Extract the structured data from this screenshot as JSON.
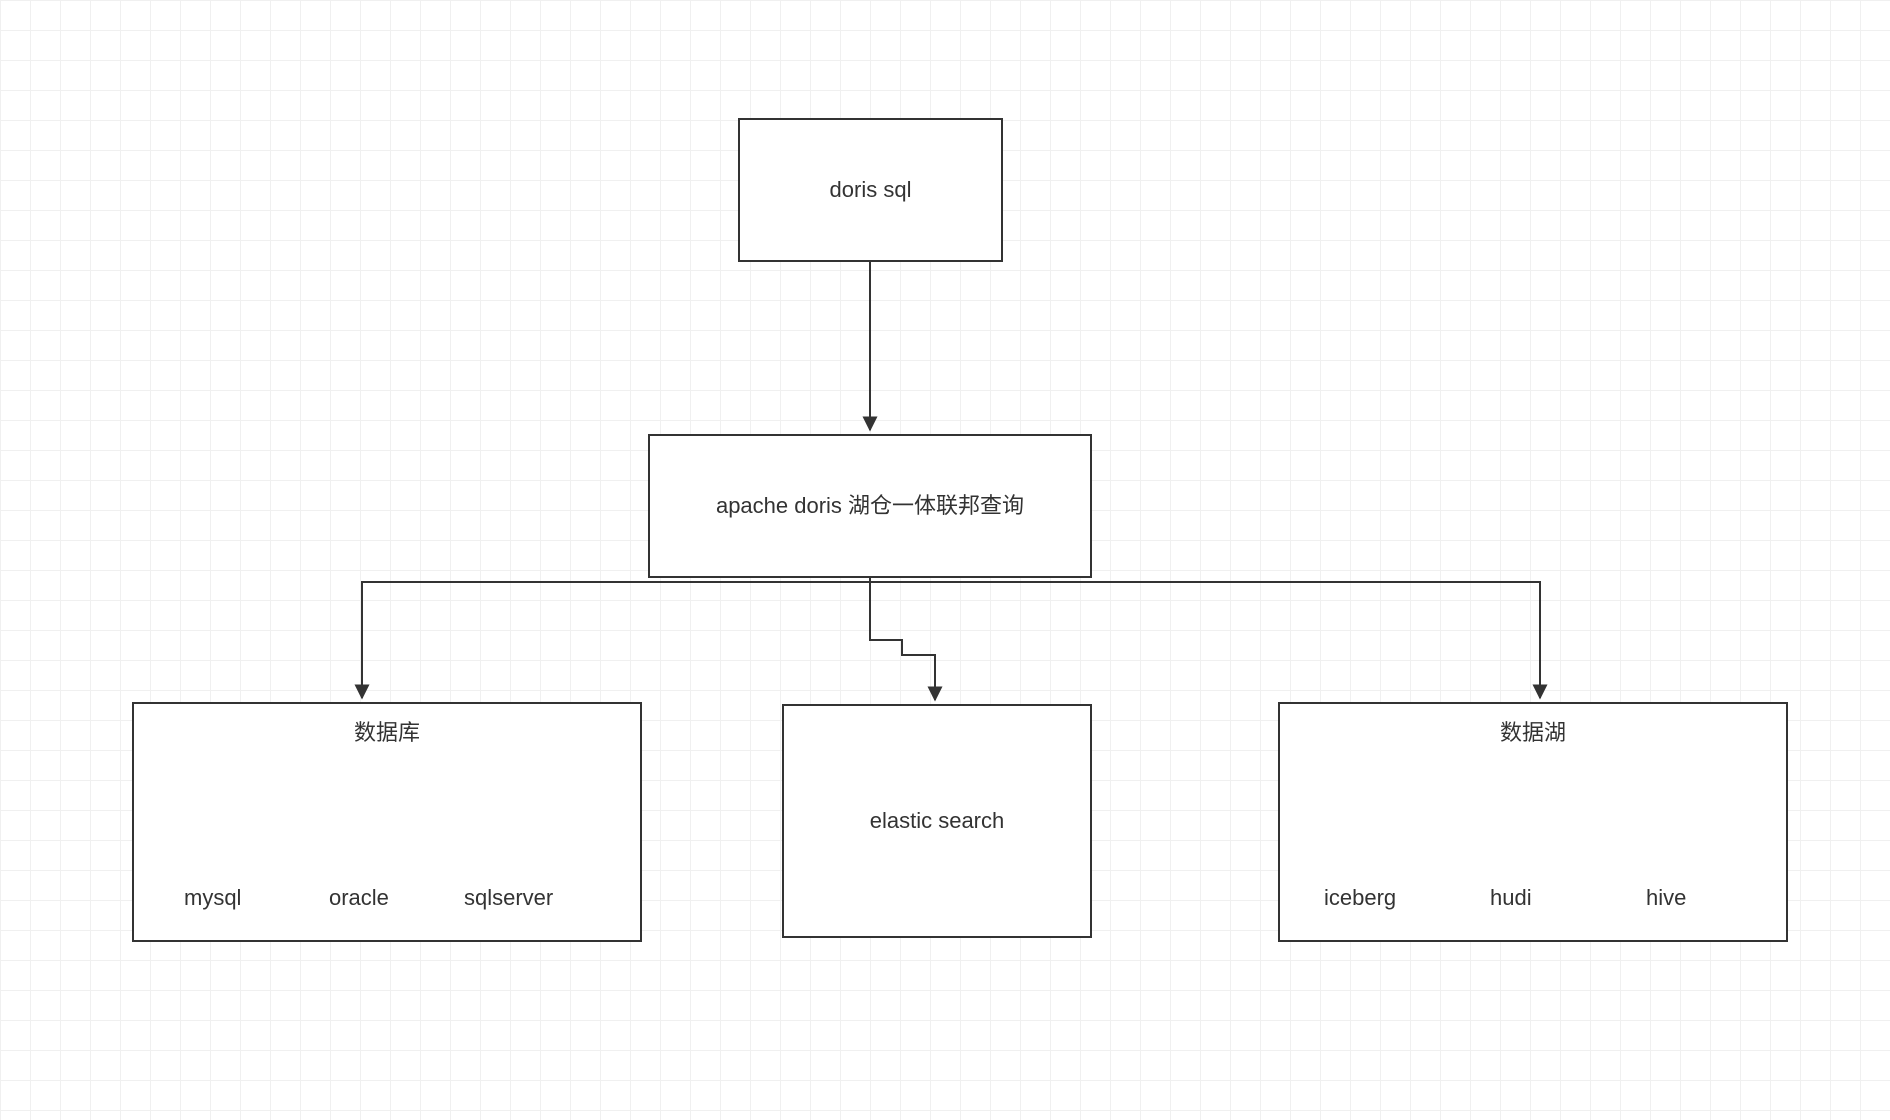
{
  "diagram": {
    "nodes": {
      "doris_sql": {
        "label": "doris sql"
      },
      "federation": {
        "label": "apache doris 湖仓一体联邦查询"
      },
      "database": {
        "title": "数据库",
        "items": [
          "mysql",
          "oracle",
          "sqlserver"
        ]
      },
      "elastic": {
        "label": "elastic search"
      },
      "datalake": {
        "title": "数据湖",
        "items": [
          "iceberg",
          "hudi",
          "hive"
        ]
      }
    }
  }
}
